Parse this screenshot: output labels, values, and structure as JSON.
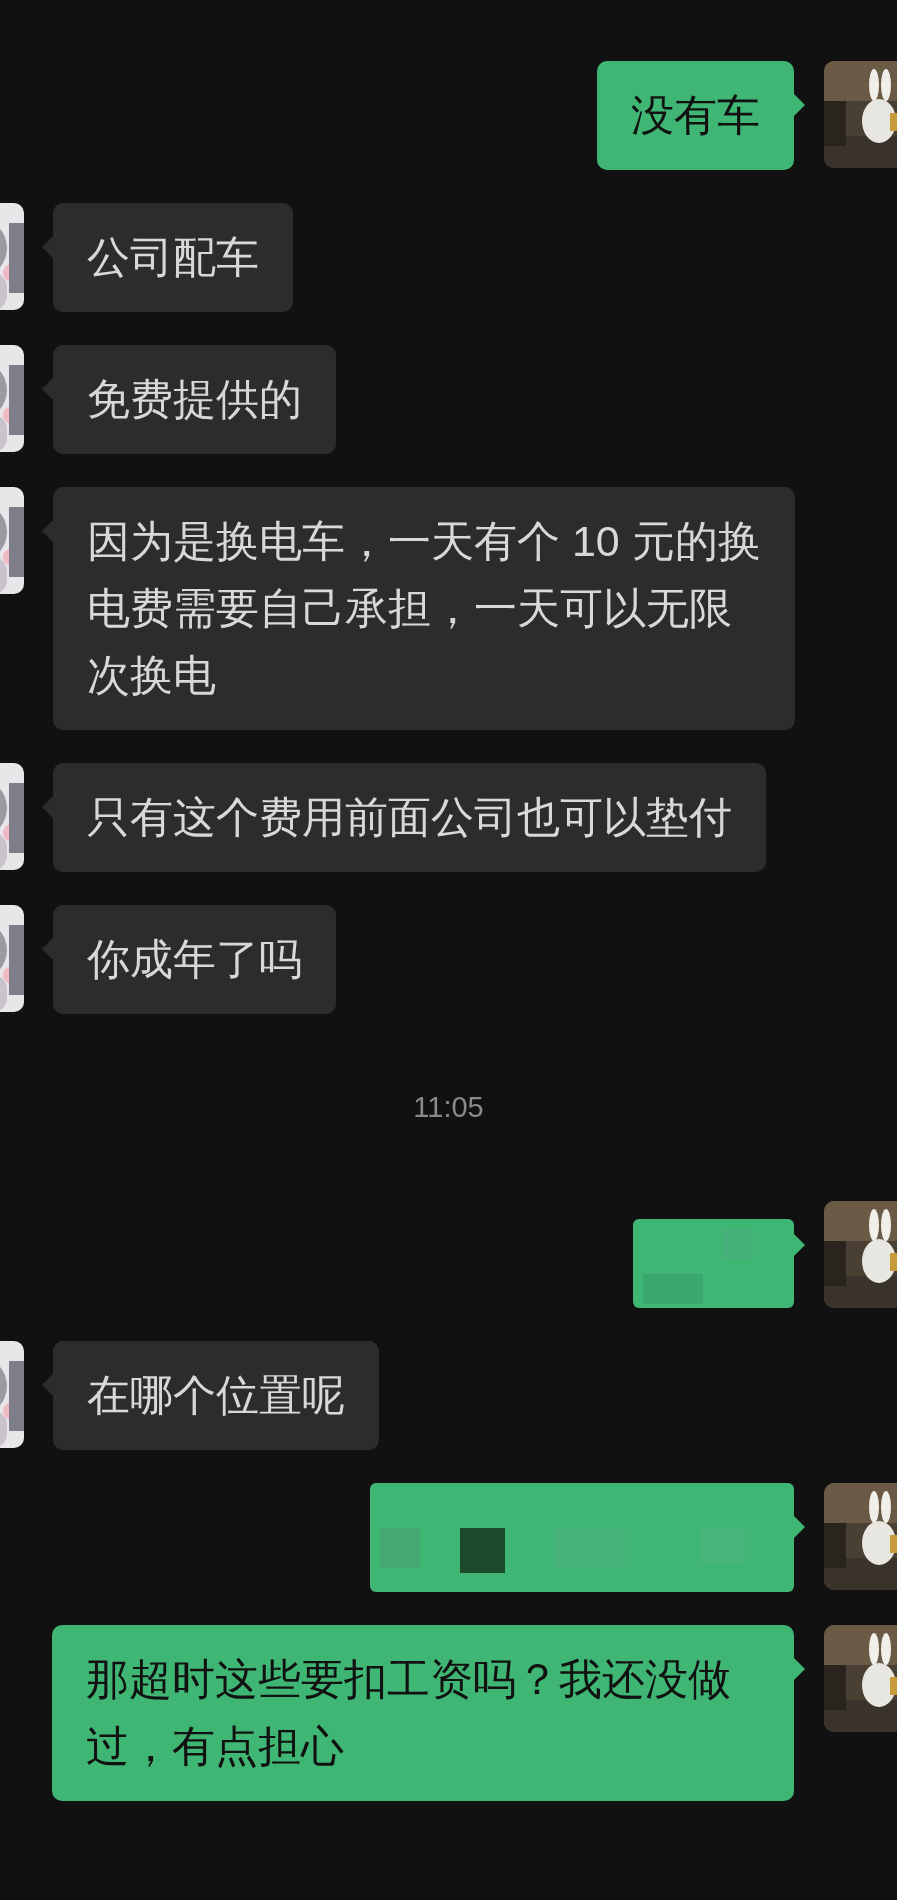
{
  "messages": [
    {
      "kind": "outgoing",
      "text": "没有车"
    },
    {
      "kind": "incoming",
      "text": "公司配车"
    },
    {
      "kind": "incoming",
      "text": "免费提供的"
    },
    {
      "kind": "incoming",
      "text": "因为是换电车，一天有个 10 元的换电费需要自己承担，一天可以无限次换电"
    },
    {
      "kind": "incoming",
      "text": "只有这个费用前面公司也可以垫付"
    },
    {
      "kind": "incoming",
      "text": "你成年了吗"
    },
    {
      "kind": "time",
      "text": "11:05"
    },
    {
      "kind": "blurred"
    },
    {
      "kind": "incoming",
      "text": "在哪个位置呢"
    },
    {
      "kind": "mosaic"
    },
    {
      "kind": "outgoing",
      "text": "那超时这些要扣工资吗？我还没做过，有点担心"
    }
  ]
}
